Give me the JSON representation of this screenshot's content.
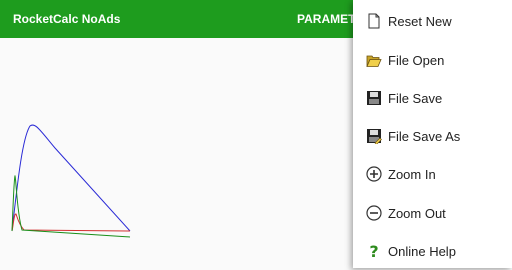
{
  "app": {
    "title": "RocketCalc NoAds",
    "tab_label": "PARAMETERS"
  },
  "colors": {
    "app_bar": "#1e9c1e",
    "curve_blue": "#2a2ad6",
    "curve_green": "#1a8f1a",
    "curve_red": "#d23030"
  },
  "menu": {
    "items": [
      {
        "label": "Reset New",
        "icon": "new-file-icon"
      },
      {
        "label": "File Open",
        "icon": "folder-open-icon"
      },
      {
        "label": "File Save",
        "icon": "floppy-disk-icon"
      },
      {
        "label": "File Save As",
        "icon": "floppy-disk-save-as-icon"
      },
      {
        "label": "Zoom In",
        "icon": "zoom-in-icon"
      },
      {
        "label": "Zoom Out",
        "icon": "zoom-out-icon"
      },
      {
        "label": "Online Help",
        "icon": "help-icon"
      }
    ]
  }
}
